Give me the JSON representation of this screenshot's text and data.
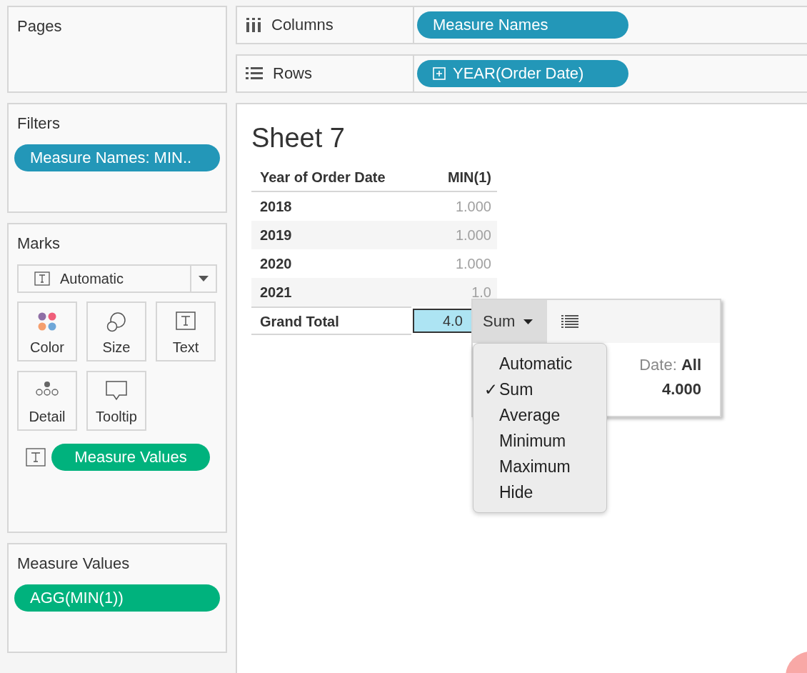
{
  "cards": {
    "pages": {
      "title": "Pages"
    },
    "filters": {
      "title": "Filters",
      "pills": [
        {
          "label": "Measure Names: MIN..",
          "kind": "dimension"
        }
      ]
    },
    "marks": {
      "title": "Marks",
      "mark_type": "Automatic",
      "buttons": [
        {
          "label": "Color",
          "kind": "color"
        },
        {
          "label": "Size",
          "kind": "size"
        },
        {
          "label": "Text",
          "kind": "text"
        },
        {
          "label": "Detail",
          "kind": "detail"
        },
        {
          "label": "Tooltip",
          "kind": "tooltip"
        }
      ],
      "fields": [
        {
          "label": "Measure Values",
          "kind": "text"
        }
      ]
    },
    "measure_values": {
      "title": "Measure Values",
      "pills": [
        {
          "label": "AGG(MIN(1))",
          "kind": "measure"
        }
      ]
    }
  },
  "shelves": [
    {
      "label": "Columns",
      "kind": "columns",
      "pills": [
        {
          "label": "Measure Names",
          "expandable": false
        }
      ]
    },
    {
      "label": "Rows",
      "kind": "rows",
      "pills": [
        {
          "label": "YEAR(Order Date)",
          "expandable": true
        }
      ]
    }
  ],
  "sheet": {
    "title": "Sheet 7",
    "columns": [
      "Year of Order Date",
      "MIN(1)"
    ],
    "rows": [
      {
        "year": "2018",
        "value": "1.000",
        "dimmed": true,
        "selected": false
      },
      {
        "year": "2019",
        "value": "1.000",
        "dimmed": true,
        "selected": false
      },
      {
        "year": "2020",
        "value": "1.000",
        "dimmed": true,
        "selected": false
      },
      {
        "year": "2021",
        "value": "1.0",
        "dimmed": true,
        "selected": false
      }
    ],
    "total": {
      "label": "Grand Total",
      "value": "4.0",
      "dimmed": false,
      "selected": true
    }
  },
  "tooltip": {
    "aggregation": "Sum",
    "field_label": "Date:",
    "field_value": "All",
    "total": "4.000"
  },
  "menu": {
    "items": [
      {
        "label": "Automatic",
        "selected": false
      },
      {
        "label": "Sum",
        "selected": true
      },
      {
        "label": "Average",
        "selected": false
      },
      {
        "label": "Minimum",
        "selected": false
      },
      {
        "label": "Maximum",
        "selected": false
      },
      {
        "label": "Hide",
        "selected": false
      }
    ],
    "check": "✓"
  }
}
